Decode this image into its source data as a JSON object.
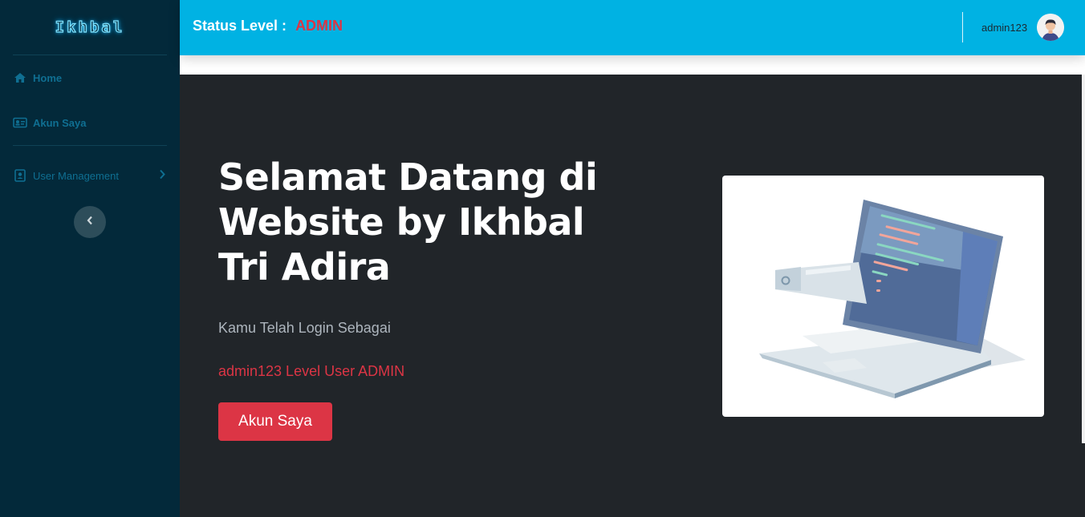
{
  "sidebar": {
    "brand": "Ikhbal",
    "items": [
      {
        "label": "Home",
        "icon": "home-icon"
      },
      {
        "label": "Akun Saya",
        "icon": "id-card-icon"
      },
      {
        "label": "User Management",
        "icon": "address-book-icon"
      }
    ]
  },
  "topbar": {
    "status_label": "Status Level :",
    "status_value": "ADMIN",
    "username": "admin123"
  },
  "hero": {
    "title": "Selamat Datang di Website by Ikhbal Tri Adira",
    "subtitle": "Kamu Telah Login Sebagai",
    "role_text": "admin123 Level User ADMIN",
    "button_label": "Akun Saya"
  },
  "colors": {
    "sidebar_bg": "#03293a",
    "topbar_bg": "#00b2e3",
    "hero_bg": "#212529",
    "accent_red": "#dc3545",
    "nav_text": "#0f6f92"
  }
}
